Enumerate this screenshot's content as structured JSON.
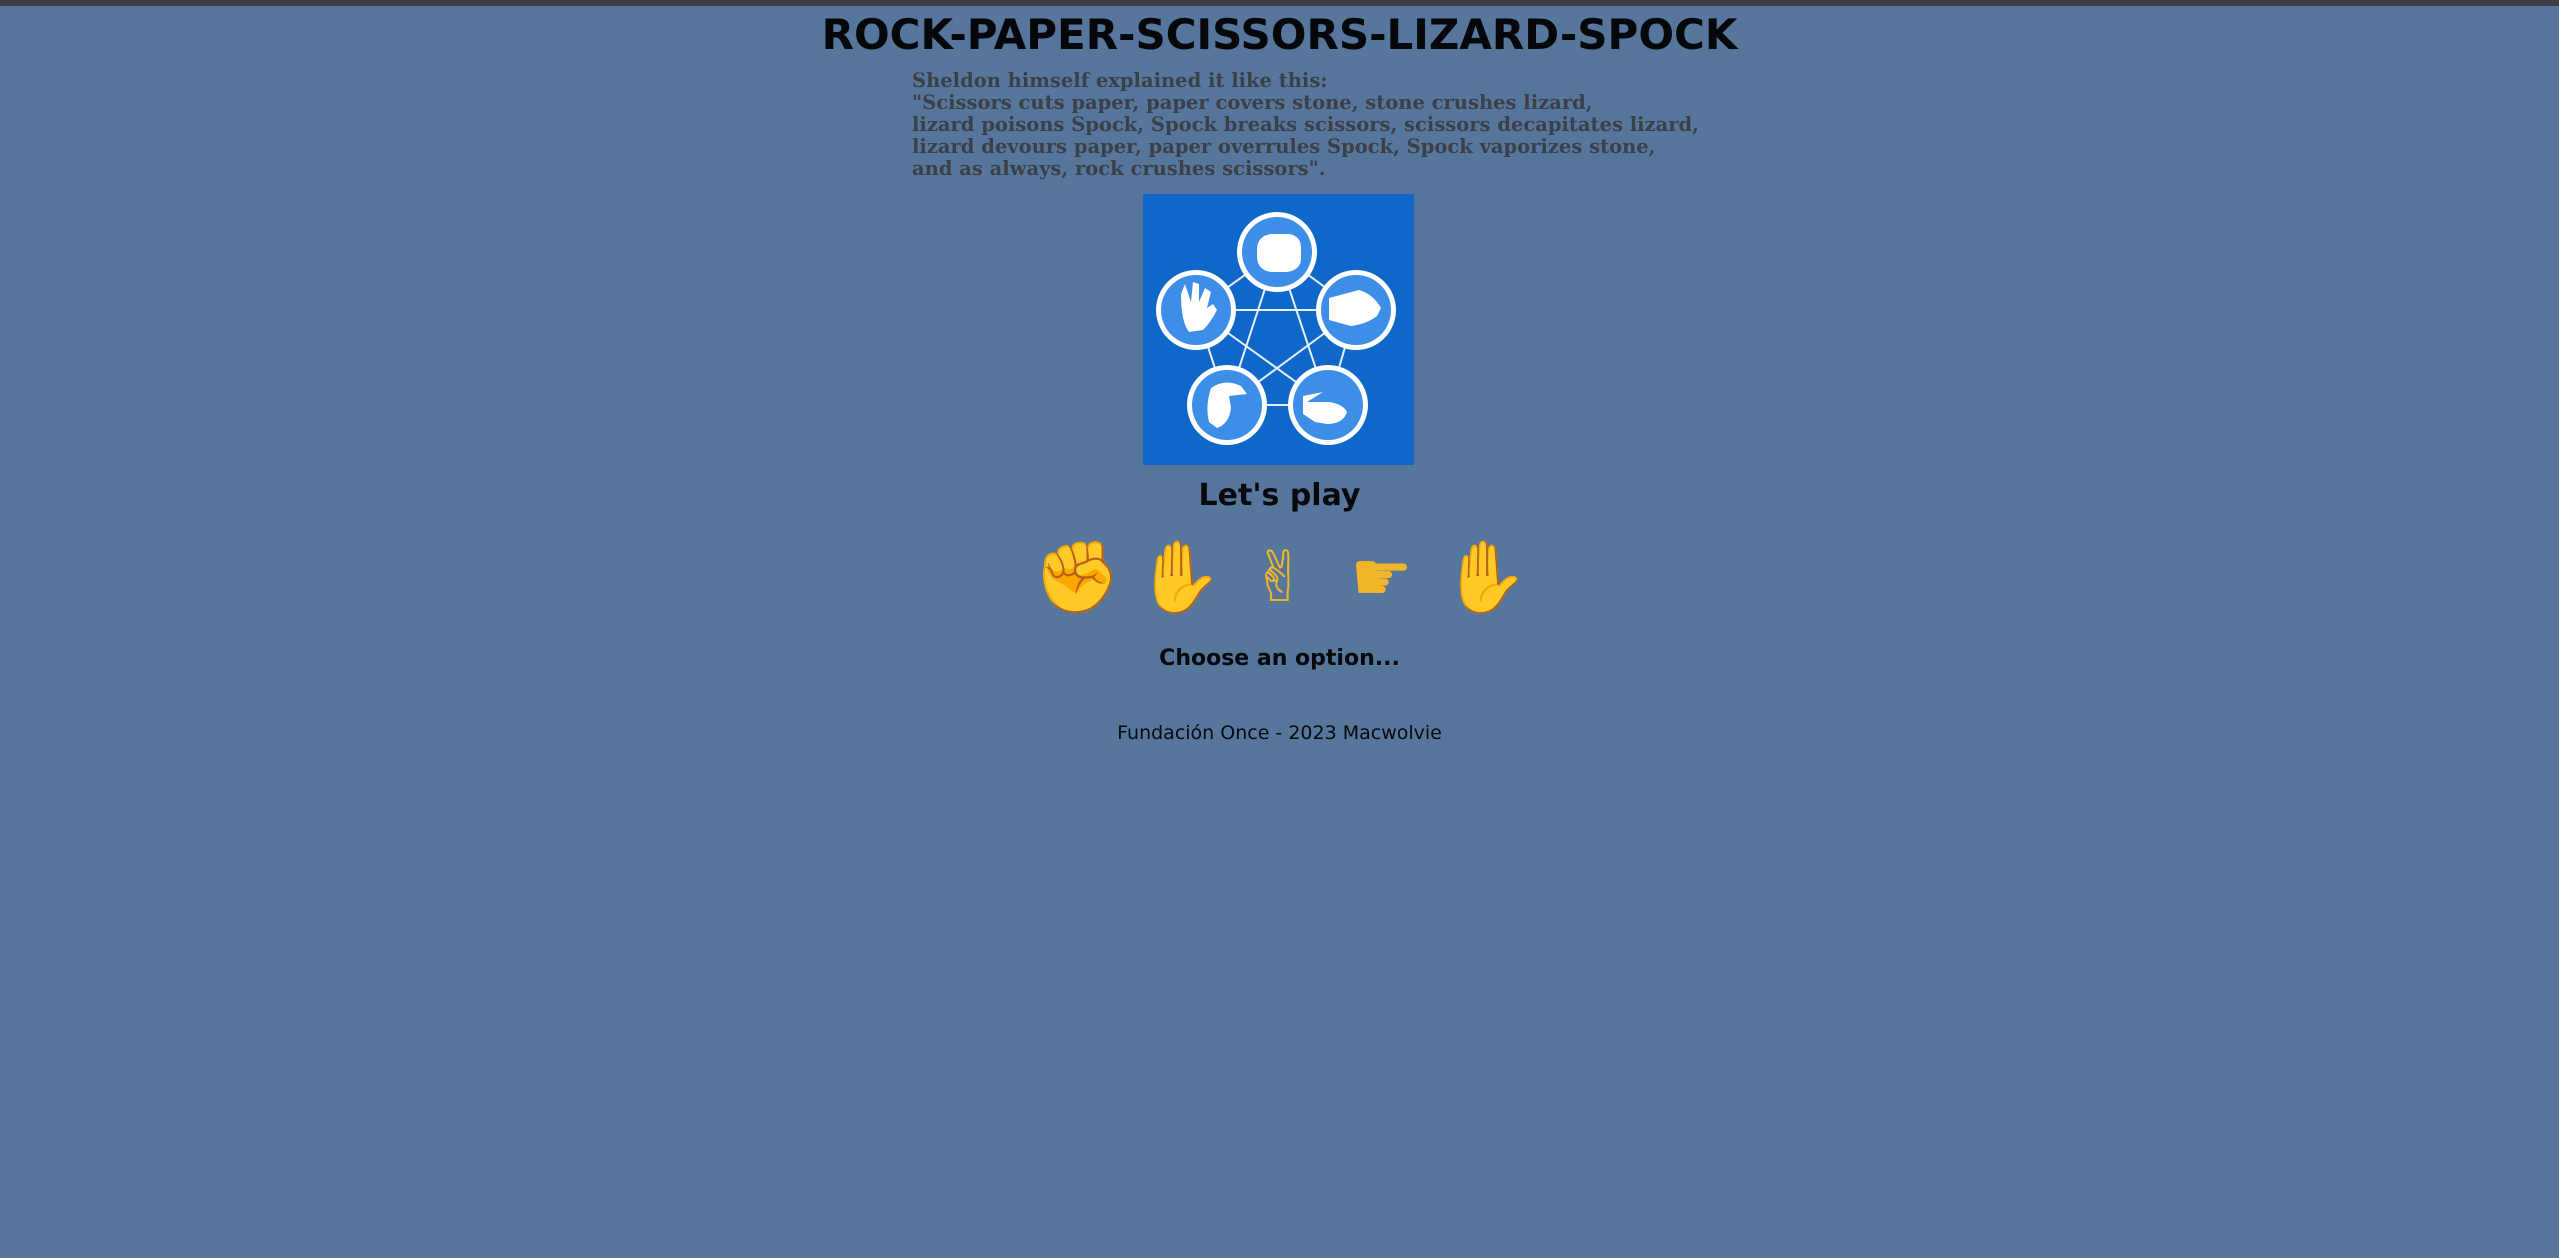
{
  "header": {
    "title": "ROCK-PAPER-SCISSORS-LIZARD-SPOCK"
  },
  "intro": {
    "lines": [
      "Sheldon himself explained it like this:",
      "\"Scissors cuts paper, paper covers stone, stone crushes lizard,",
      "lizard poisons Spock, Spock breaks scissors, scissors decapitates lizard,",
      "lizard devours paper, paper overrules Spock, Spock vaporizes stone,",
      "and as always, rock crushes scissors\"."
    ]
  },
  "diagram": {
    "background": "#0f68c9",
    "circle_fill": "#3c8ee6",
    "icons": [
      "rock-hand-icon",
      "paper-hand-icon",
      "scissors-hand-icon",
      "lizard-hand-icon",
      "spock-hand-icon"
    ]
  },
  "game": {
    "heading": "Let's play",
    "options": [
      {
        "glyph": "✊",
        "icon": "rock-icon"
      },
      {
        "glyph": "✋",
        "icon": "paper-icon"
      },
      {
        "glyph": "✌",
        "icon": "scissors-icon"
      },
      {
        "glyph": "☛",
        "icon": "lizard-icon"
      },
      {
        "glyph": "✋",
        "icon": "spock-icon"
      }
    ],
    "status": "Choose an option..."
  },
  "footer": {
    "text": "Fundación Once - 2023 Macwolvie"
  },
  "colors": {
    "page_background": "#56769b",
    "top_bar": "#3d3f44",
    "text": "#07090d",
    "quote_text": "#3a3f48",
    "emoji": "#f1b52a"
  }
}
